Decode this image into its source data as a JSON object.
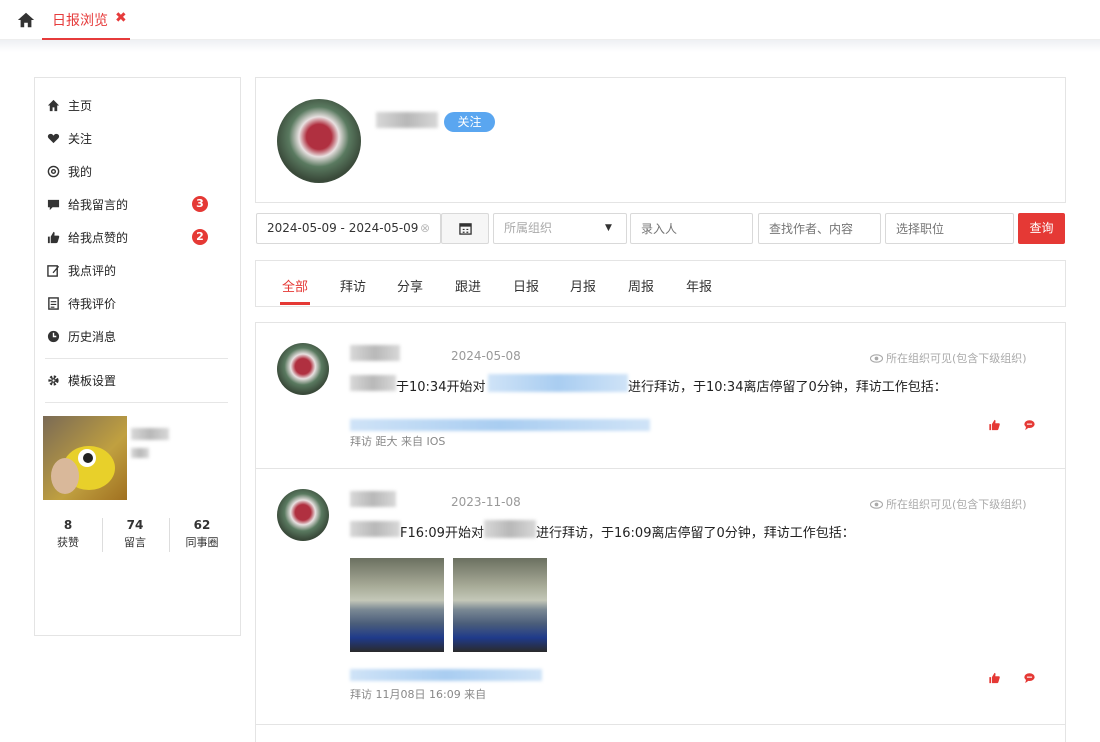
{
  "topbar": {
    "tab_label": "日报浏览",
    "close_glyph": "✖"
  },
  "sidebar": {
    "items": [
      {
        "label": "主页",
        "icon": "home-icon"
      },
      {
        "label": "关注",
        "icon": "heart-icon"
      },
      {
        "label": "我的",
        "icon": "at-icon"
      },
      {
        "label": "给我留言的",
        "icon": "comment-icon",
        "badge": "3"
      },
      {
        "label": "给我点赞的",
        "icon": "thumbs-up-icon",
        "badge": "2"
      },
      {
        "label": "我点评的",
        "icon": "edit-icon"
      },
      {
        "label": "待我评价",
        "icon": "clipboard-icon"
      },
      {
        "label": "历史消息",
        "icon": "clock-icon"
      }
    ],
    "settings_label": "模板设置",
    "stats": [
      {
        "value": "8",
        "label": "获赞"
      },
      {
        "value": "74",
        "label": "留言"
      },
      {
        "value": "62",
        "label": "同事圈"
      }
    ]
  },
  "profile": {
    "follow_label": "关注"
  },
  "filters": {
    "date_range": "2024-05-09 - 2024-05-09",
    "org_placeholder": "所属组织",
    "recorder_placeholder": "录入人",
    "search_placeholder": "查找作者、内容",
    "position_placeholder": "选择职位",
    "query_label": "查询"
  },
  "tabs": [
    "全部",
    "拜访",
    "分享",
    "跟进",
    "日报",
    "月报",
    "周报",
    "年报"
  ],
  "active_tab": "全部",
  "accent_color": "#e53935",
  "posts": [
    {
      "date": "2024-05-08",
      "visibility": "所在组织可见(包含下级组织)",
      "text_a": "于10:34开始对",
      "text_b": "进行拜访，于10:34离店停留了0分钟，拜访工作包括：",
      "meta": "拜访  距大  来自 IOS"
    },
    {
      "date": "2023-11-08",
      "visibility": "所在组织可见(包含下级组织)",
      "text_a": "F16:09开始对",
      "text_b": "进行拜访，于16:09离店停留了0分钟，拜访工作包括：",
      "meta": "拜访  11月08日 16:09  来自"
    }
  ]
}
